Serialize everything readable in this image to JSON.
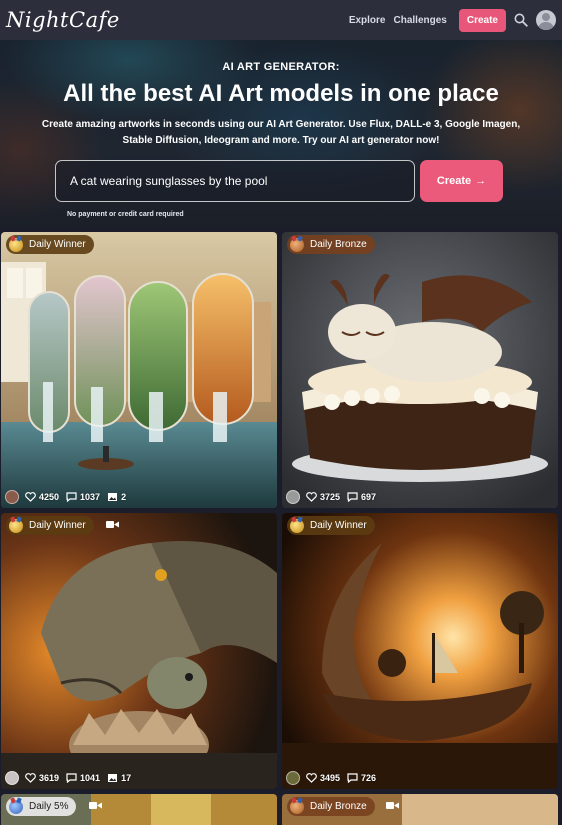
{
  "nav": {
    "logo": "NightCafe",
    "links": [
      "Explore",
      "Challenges"
    ],
    "create_label": "Create"
  },
  "hero": {
    "eyebrow": "AI ART GENERATOR:",
    "title": "All the best AI Art models in one place",
    "subtitle": "Create amazing artworks in seconds using our AI Art Generator. Use Flux, DALL-e 3, Google Imagen, Stable Diffusion, Ideogram and more. Try our AI art generator now!",
    "prompt_value": "A cat wearing sunglasses by the pool",
    "create_label": "Create",
    "note": "No payment or credit card required"
  },
  "cards": [
    {
      "badge": "Daily Winner",
      "likes": "4250",
      "comments": "1037",
      "images": "2",
      "video": false
    },
    {
      "badge": "Daily Bronze",
      "likes": "3725",
      "comments": "697",
      "images": "",
      "video": false
    },
    {
      "badge": "Daily Winner",
      "likes": "3619",
      "comments": "1041",
      "images": "17",
      "video": true
    },
    {
      "badge": "Daily Winner",
      "likes": "3495",
      "comments": "726",
      "images": "",
      "video": false
    },
    {
      "badge": "Daily 5%",
      "video": true
    },
    {
      "badge": "Daily Bronze",
      "video": true
    }
  ],
  "icons": {
    "search": "search-icon",
    "heart": "heart-icon",
    "comment": "comment-icon",
    "images": "images-icon",
    "video": "video-camera-icon",
    "medal": "medal-icon"
  },
  "colors": {
    "navbar": "#2c2e3b",
    "accent": "#e8577a"
  }
}
